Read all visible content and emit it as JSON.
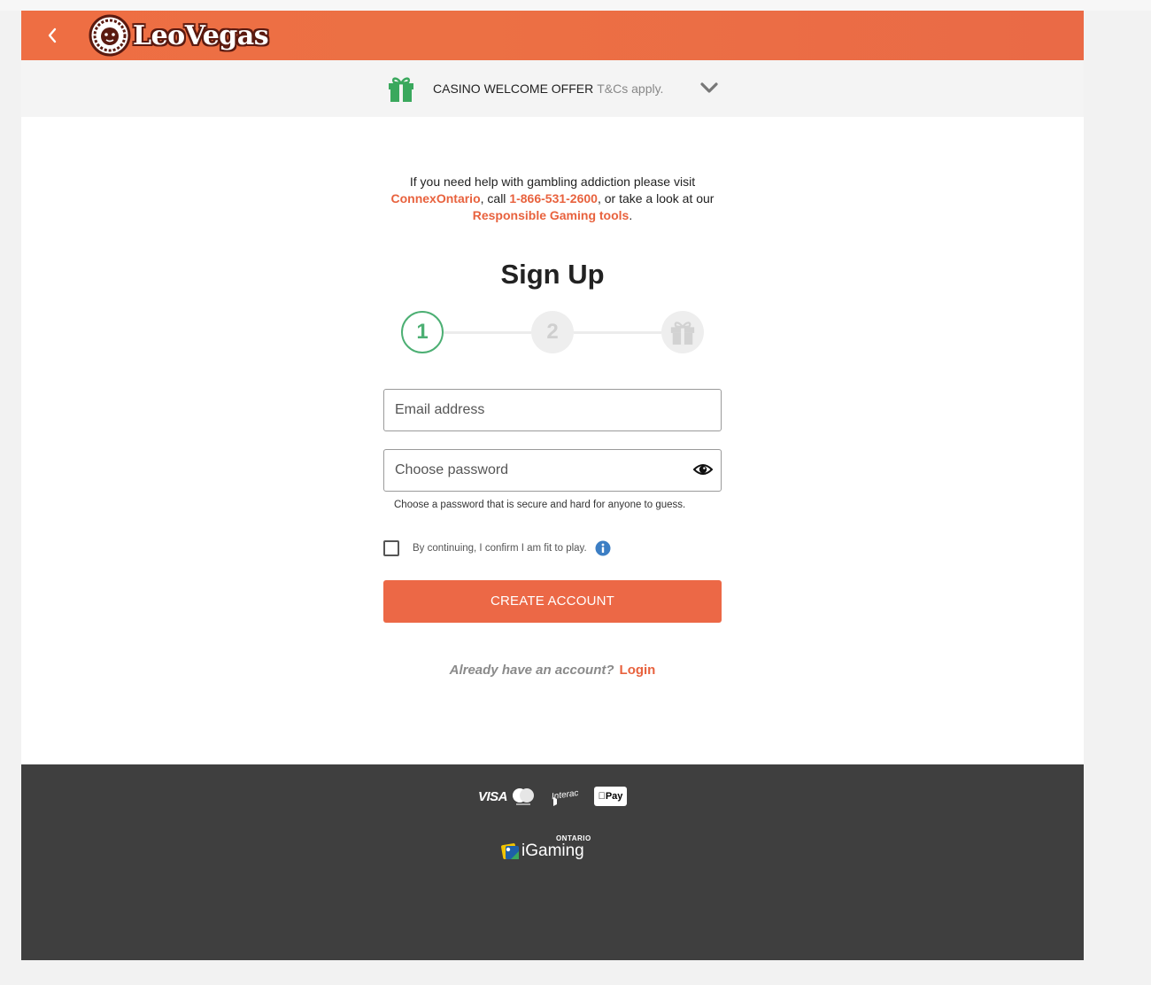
{
  "browser": {
    "top_text": ""
  },
  "header": {
    "brand": "LeoVegas",
    "back_icon": "chevron-left-icon",
    "logo_icon": "lion-logo-icon"
  },
  "offer": {
    "title": "CASINO WELCOME OFFER",
    "terms": "T&Cs apply.",
    "gift_icon": "gift-icon",
    "expand_icon": "chevron-down-icon",
    "gift_color": "#3aa85d"
  },
  "help": {
    "line1": "If you need help with gambling addiction please visit",
    "link_connex": "ConnexOntario",
    "text_call": ", call ",
    "link_phone": "1-866-531-2600",
    "text_look": ", or take a look at our",
    "link_tools": "Responsible Gaming tools",
    "text_end": "."
  },
  "form": {
    "title": "Sign Up",
    "steps": [
      {
        "label": "1",
        "state": "active"
      },
      {
        "label": "2",
        "state": "inactive"
      },
      {
        "label": "",
        "icon": "gift-icon",
        "state": "inactive"
      }
    ],
    "email_placeholder": "Email address",
    "email_value": "",
    "password_placeholder": "Choose password",
    "password_value": "",
    "password_hint": "Choose a password that is secure and hard for anyone to guess.",
    "fit_to_play_label": "By continuing, I confirm I am fit to play.",
    "fit_to_play_checked": false,
    "create_button": "CREATE ACCOUNT",
    "already_text": "Already have an account?",
    "login_link": "Login"
  },
  "footer": {
    "payments": {
      "visa": "VISA",
      "mastercard_icon": "mastercard-icon",
      "interac_icon": "interac-icon",
      "applepay": "Pay"
    },
    "igaming": {
      "ontario": "ONTARIO",
      "name": "iGaming"
    }
  },
  "colors": {
    "brand_orange": "#ec6846",
    "step_active": "#4caf73",
    "link": "#e8623e",
    "footer_bg": "#3f3f3f"
  }
}
